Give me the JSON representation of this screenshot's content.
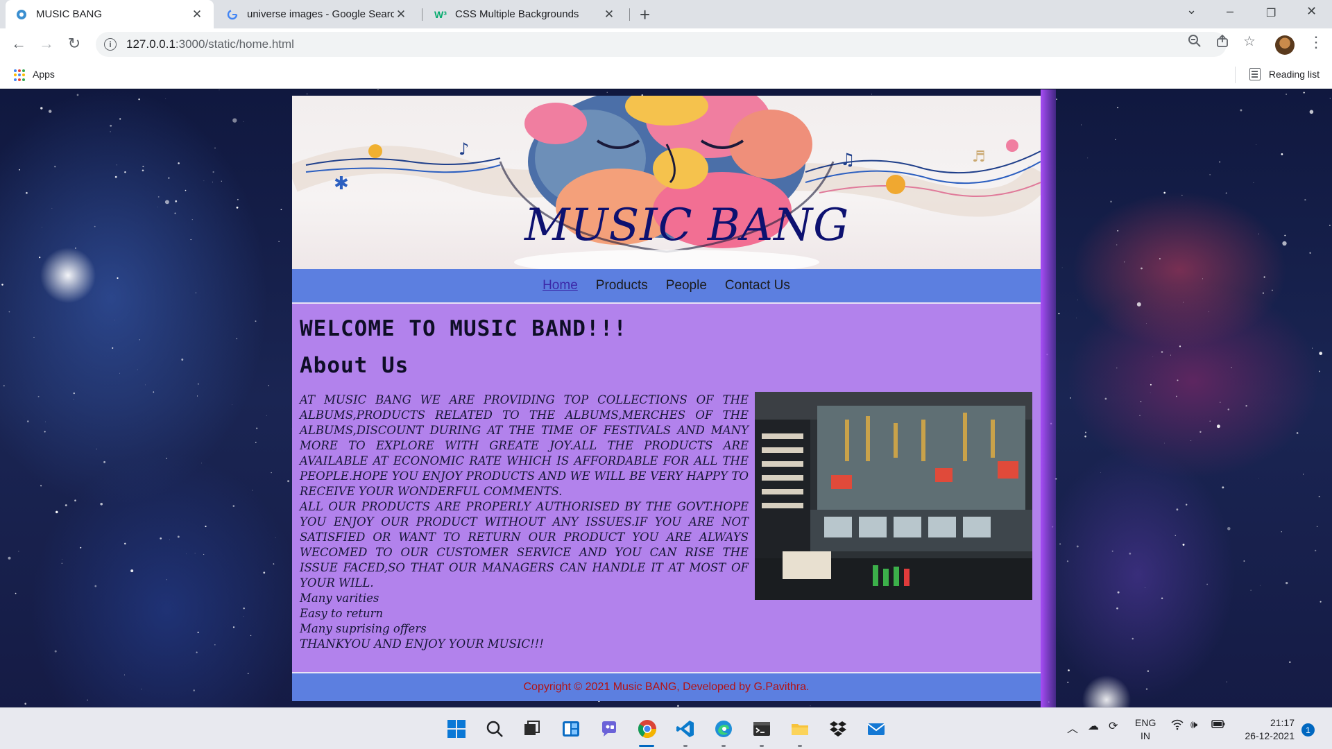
{
  "browser": {
    "tabs": [
      {
        "title": "MUSIC BANG",
        "active": true
      },
      {
        "title": "universe images - Google Search",
        "active": false
      },
      {
        "title": "CSS Multiple Backgrounds",
        "active": false
      }
    ],
    "url_host": "127.0.0.1",
    "url_rest": ":3000/static/home.html",
    "bookmarks": {
      "apps_label": "Apps",
      "reading_list_label": "Reading list"
    }
  },
  "site": {
    "banner_title": "MUSIC BANG",
    "nav": [
      {
        "label": "Home",
        "current": true
      },
      {
        "label": "Products",
        "current": false
      },
      {
        "label": "People",
        "current": false
      },
      {
        "label": "Contact Us",
        "current": false
      }
    ],
    "welcome_heading": "WELCOME TO MUSIC BAND!!!",
    "about_heading": "About Us",
    "about_paragraph_1": "AT MUSIC BANG WE ARE PROVIDING TOP COLLECTIONS OF THE ALBUMS,PRODUCTS RELATED TO THE ALBUMS,MERCHES OF THE ALBUMS,DISCOUNT DURING AT THE TIME OF FESTIVALS AND MANY MORE TO EXPLORE WITH GREATE JOY.ALL THE PRODUCTS ARE AVAILABLE AT ECONOMIC RATE WHICH IS AFFORDABLE FOR ALL THE PEOPLE.HOPE YOU ENJOY PRODUCTS AND WE WILL BE VERY HAPPY TO RECEIVE YOUR WONDERFUL COMMENTS.",
    "about_paragraph_2": "ALL OUR PRODUCTS ARE PROPERLY AUTHORISED BY THE GOVT.HOPE YOU ENJOY OUR PRODUCT WITHOUT ANY ISSUES.IF YOU ARE NOT SATISFIED OR WANT TO RETURN OUR PRODUCT YOU ARE ALWAYS WECOMED TO OUR CUSTOMER SERVICE AND YOU CAN RISE THE ISSUE FACED,SO THAT OUR MANAGERS CAN HANDLE IT AT MOST OF YOUR WILL.",
    "features": [
      "Many varities",
      "Easy to return",
      "Many suprising offers"
    ],
    "thanks": "THANKYOU AND ENJOY YOUR MUSIC!!!",
    "footer": "Copyright © 2021 Music BANG, Developed by G.Pavithra."
  },
  "taskbar": {
    "language": "ENG",
    "region": "IN",
    "time": "21:17",
    "date": "26-12-2021",
    "notifications": "1"
  }
}
